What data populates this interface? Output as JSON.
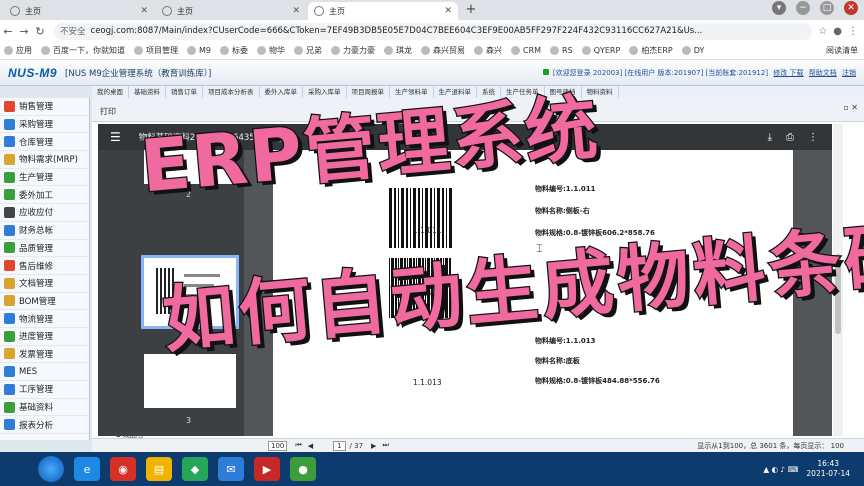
{
  "browser": {
    "tabs": [
      {
        "label": "主页",
        "active": false
      },
      {
        "label": "主页",
        "active": false
      },
      {
        "label": "主页",
        "active": true
      }
    ],
    "insecure_label": "不安全",
    "url": "ceogj.com:8087/Main/index?CUserCode=666&CToken=7EF49B3DB5E05E7D04C7BEE604C3EF9E00AB5FF297F224F432C93116CC627A21&Us...",
    "bookmarks": [
      "应用",
      "百度一下，你就知道",
      "项目管理",
      "M9",
      "标委",
      "物华",
      "兄弟",
      "力豪力豪",
      "琪龙",
      "森兴贸易",
      "森兴",
      "CRM",
      "RS",
      "QYERP",
      "柏杰ERP",
      "DY"
    ],
    "reading_list": "阅读清单"
  },
  "app": {
    "logo": "NUS-M9",
    "title": "[NUS M9企业管理系统（教育训练库）]",
    "status_text": "[欢迎您登录 202003] [在线用户 版本:201907] [当前账套:201912]",
    "status_links": [
      "修改 下载",
      "帮助文档",
      "注销"
    ]
  },
  "module_tabs": [
    "我的桌面",
    "基础资料",
    "销售订单",
    "项目成本分析表",
    "委外入库单",
    "采购入库单",
    "项目周报单",
    "生产领料单",
    "生产退料单",
    "系统",
    "生产任务单",
    "图号建档",
    "物料资料"
  ],
  "sidebar": {
    "items": [
      {
        "label": "销售管理",
        "color": "#e0452e"
      },
      {
        "label": "采购管理",
        "color": "#2e7dd8"
      },
      {
        "label": "仓库管理",
        "color": "#2e7dd8"
      },
      {
        "label": "物料需求(MRP)",
        "color": "#d8a52e"
      },
      {
        "label": "生产管理",
        "color": "#3a9e3a"
      },
      {
        "label": "委外加工",
        "color": "#3a9e3a"
      },
      {
        "label": "应收应付",
        "color": "#444444"
      },
      {
        "label": "财务总帐",
        "color": "#2e7dd8"
      },
      {
        "label": "品质管理",
        "color": "#3a9e3a"
      },
      {
        "label": "售后维修",
        "color": "#e0452e"
      },
      {
        "label": "文档管理",
        "color": "#d8a52e"
      },
      {
        "label": "BOM管理",
        "color": "#d8a52e"
      },
      {
        "label": "物流管理",
        "color": "#2e7dd8"
      },
      {
        "label": "进度管理",
        "color": "#3a9e3a"
      },
      {
        "label": "发票管理",
        "color": "#d8a52e"
      },
      {
        "label": "MES",
        "color": "#2e7dd8"
      },
      {
        "label": "工序管理",
        "color": "#2e7dd8"
      },
      {
        "label": "基础资料",
        "color": "#3a9e3a"
      },
      {
        "label": "报表分析",
        "color": "#2e7dd8"
      }
    ]
  },
  "print_window": {
    "title": "打印",
    "pdf_name": "物料基础资料2021714164354357.pdf",
    "thumbnail_numbers": [
      "2",
      "3"
    ]
  },
  "barcodes": [
    {
      "number": "1.1.011",
      "code_line": "物料编号:1.1.011",
      "name_line": "物料名称:侧板-右",
      "spec_line": "物料规格:0.8-镀锌板606.2*858.76"
    },
    {
      "number": "1.1.013",
      "code_line": "物料编号:1.1.013",
      "name_line": "物料名称:底板",
      "spec_line": "物料规格:0.8-镀锌板484.88*556.76"
    }
  ],
  "pager": {
    "page_size": "100",
    "page_input": "1",
    "page_total": "/ 37",
    "record_info": "显示从1到100，总 3601 条，每页显示：",
    "page_size_right": "100",
    "tree_label": "成品仓"
  },
  "overlay": {
    "line1": "ERP管理系统",
    "line2": "如何自动生成物料条码"
  },
  "taskbar": {
    "apps": [
      {
        "label": "e",
        "color": "#1e88e5"
      },
      {
        "label": "◉",
        "color": "#d93025"
      },
      {
        "label": "▤",
        "color": "#f0b400"
      },
      {
        "label": "◆",
        "color": "#26a65b"
      },
      {
        "label": "✉",
        "color": "#2e7dd8"
      },
      {
        "label": "▶",
        "color": "#c62828"
      },
      {
        "label": "●",
        "color": "#3a9e3a"
      }
    ],
    "time": "16:43",
    "date": "2021-07-14"
  }
}
